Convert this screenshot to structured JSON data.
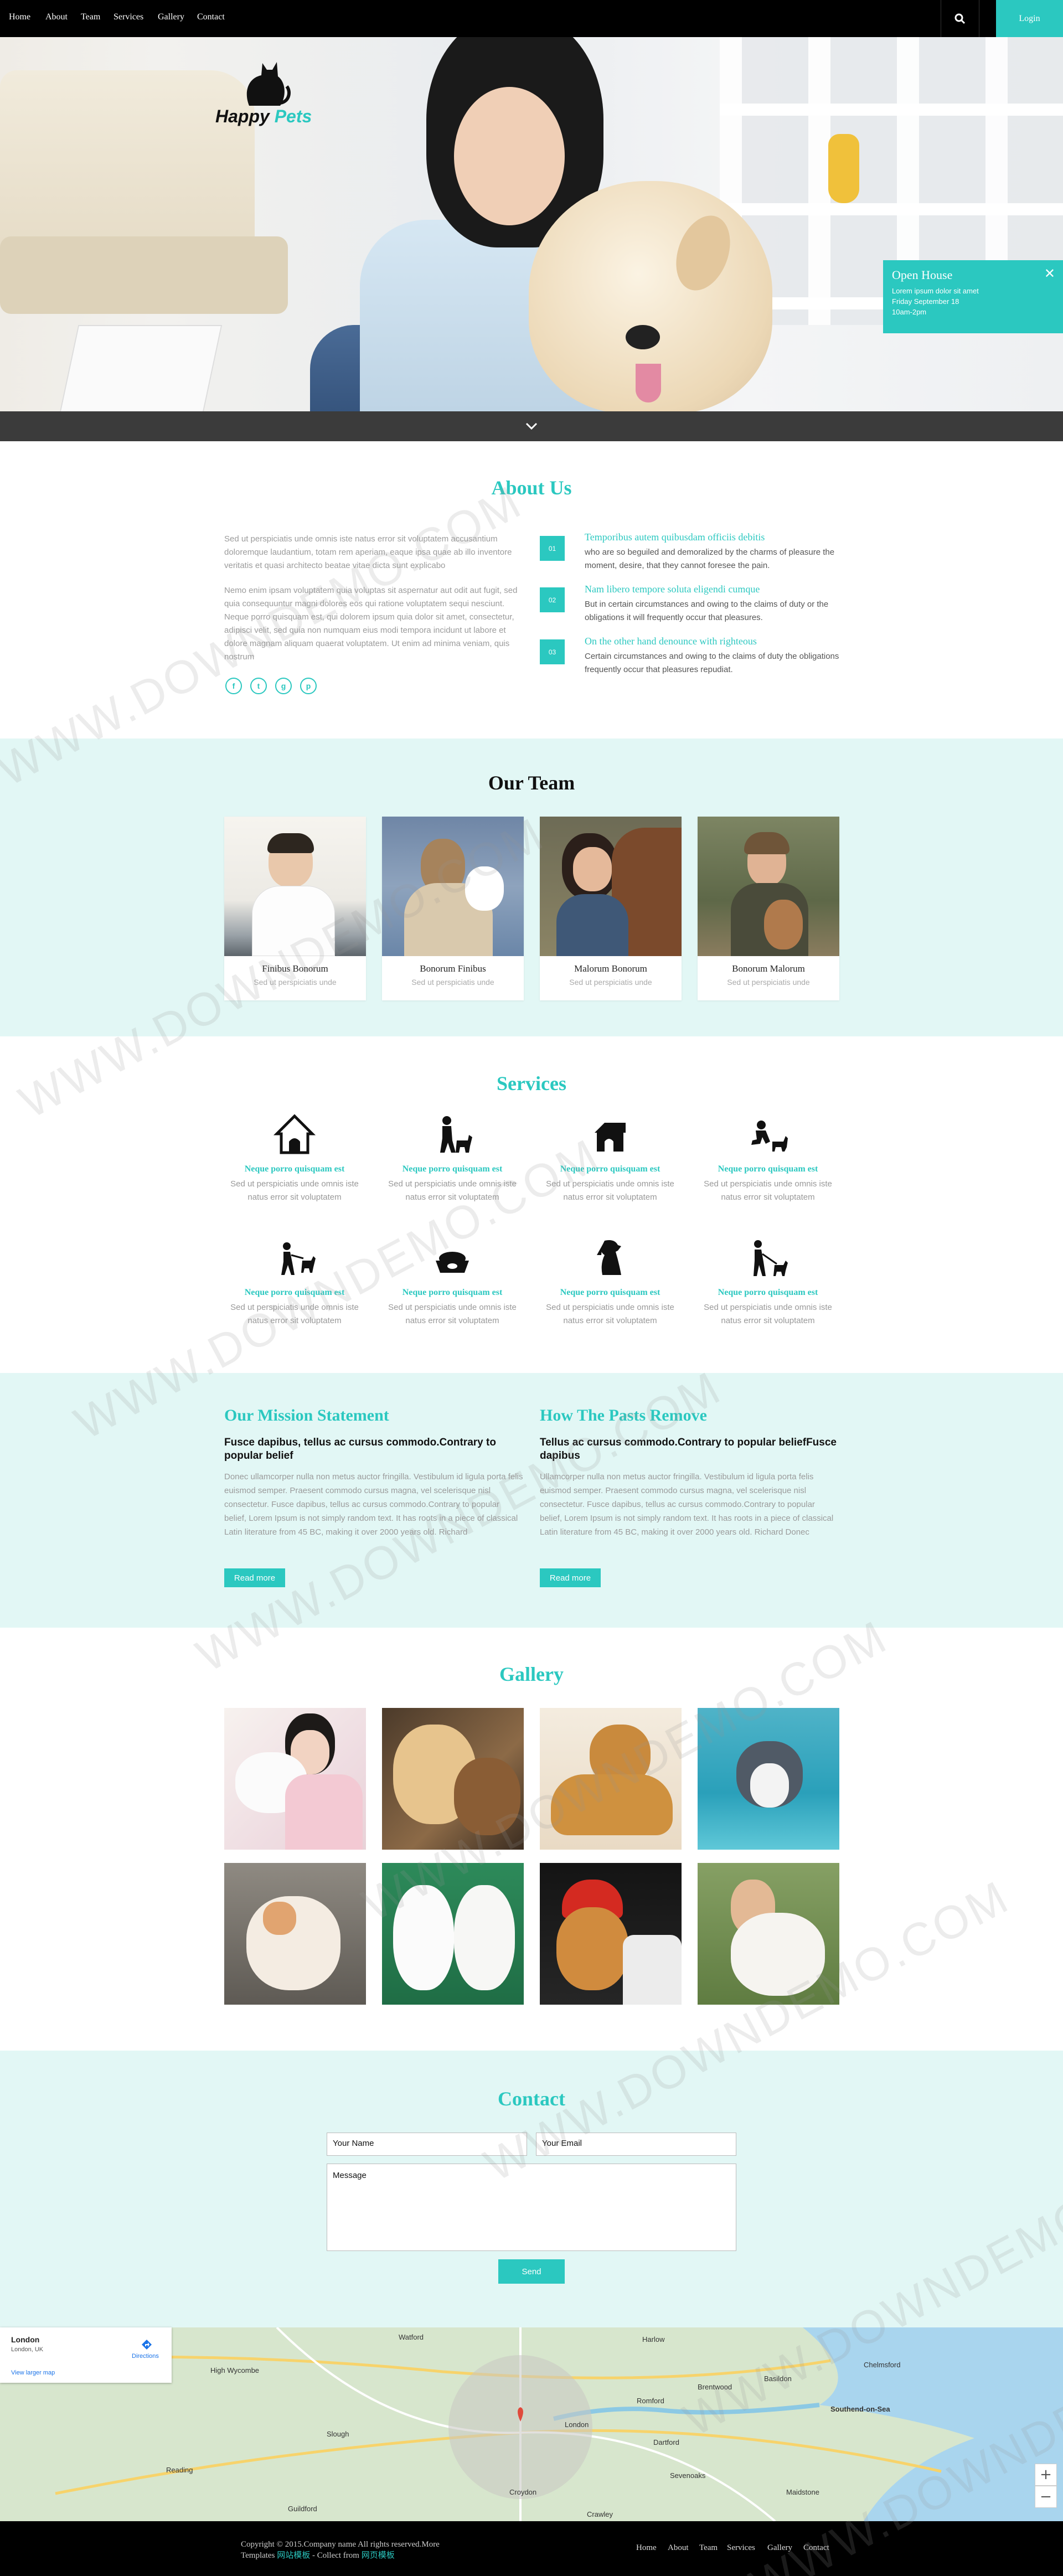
{
  "nav": {
    "items": [
      "Home",
      "About",
      "Team",
      "Services",
      "Gallery",
      "Contact"
    ],
    "login": "Login",
    "search_icon": "search-icon"
  },
  "hero": {
    "logo_word1": "Happy",
    "logo_word2": "Pets",
    "open_house": {
      "title": "Open House",
      "line1": "Lorem ipsum dolor sit amet",
      "line2": "Friday September 18",
      "line3": "10am-2pm",
      "close": "✕"
    }
  },
  "about": {
    "title": "About Us",
    "p1": "Sed ut perspiciatis unde omnis iste natus error sit voluptatem accusantium doloremque laudantium, totam rem aperiam, eaque ipsa quae ab illo inventore veritatis et quasi architecto beatae vitae dicta sunt explicabo",
    "p2": "Nemo enim ipsam voluptatem quia voluptas sit aspernatur aut odit aut fugit, sed quia consequuntur magni dolores eos qui ratione voluptatem sequi nesciunt. Neque porro quisquam est, qui dolorem ipsum quia dolor sit amet, consectetur, adipisci velit, sed quia non numquam eius modi tempora incidunt ut labore et dolore magnam aliquam quaerat voluptatem. Ut enim ad minima veniam, quis nostrum",
    "social": [
      "f",
      "t",
      "g",
      "p"
    ],
    "features": [
      {
        "num": "01",
        "title": "Temporibus autem quibusdam officiis debitis",
        "text": "who are so beguiled and demoralized by the charms of pleasure the moment, desire, that they cannot foresee the pain."
      },
      {
        "num": "02",
        "title": "Nam libero tempore soluta eligendi cumque",
        "text": "But in certain circumstances and owing to the claims of duty or the obligations it will frequently occur that pleasures."
      },
      {
        "num": "03",
        "title": "On the other hand denounce with righteous",
        "text": "Certain circumstances and owing to the claims of duty the obligations frequently occur that pleasures repudiat."
      }
    ]
  },
  "team": {
    "title": "Our Team",
    "members": [
      {
        "name": "Finibus Bonorum",
        "sub": "Sed ut perspiciatis unde"
      },
      {
        "name": "Bonorum Finibus",
        "sub": "Sed ut perspiciatis unde"
      },
      {
        "name": "Malorum Bonorum",
        "sub": "Sed ut perspiciatis unde"
      },
      {
        "name": "Bonorum Malorum",
        "sub": "Sed ut perspiciatis unde"
      }
    ]
  },
  "services": {
    "title": "Services",
    "items": [
      {
        "icon": "dog-house-icon",
        "title": "Neque porro quisquam est",
        "text": "Sed ut perspiciatis unde omnis iste natus error sit voluptatem"
      },
      {
        "icon": "dog-training-icon",
        "title": "Neque porro quisquam est",
        "text": "Sed ut perspiciatis unde omnis iste natus error sit voluptatem"
      },
      {
        "icon": "kennel-icon",
        "title": "Neque porro quisquam est",
        "text": "Sed ut perspiciatis unde omnis iste natus error sit voluptatem"
      },
      {
        "icon": "pet-grooming-icon",
        "title": "Neque porro quisquam est",
        "text": "Sed ut perspiciatis unde omnis iste natus error sit voluptatem"
      },
      {
        "icon": "dog-walking-icon",
        "title": "Neque porro quisquam est",
        "text": "Sed ut perspiciatis unde omnis iste natus error sit voluptatem"
      },
      {
        "icon": "pet-bowl-icon",
        "title": "Neque porro quisquam est",
        "text": "Sed ut perspiciatis unde omnis iste natus error sit voluptatem"
      },
      {
        "icon": "sitting-dog-icon",
        "title": "Neque porro quisquam est",
        "text": "Sed ut perspiciatis unde omnis iste natus error sit voluptatem"
      },
      {
        "icon": "dog-leash-icon",
        "title": "Neque porro quisquam est",
        "text": "Sed ut perspiciatis unde omnis iste natus error sit voluptatem"
      }
    ]
  },
  "mission": {
    "left": {
      "title": "Our Mission Statement",
      "sub": "Fusce dapibus, tellus ac cursus commodo.Contrary to popular belief",
      "text": "Donec ullamcorper nulla non metus auctor fringilla. Vestibulum id ligula porta felis euismod semper. Praesent commodo cursus magna, vel scelerisque nisl consectetur. Fusce dapibus, tellus ac cursus commodo.Contrary to popular belief, Lorem Ipsum is not simply random text. It has roots in a piece of classical Latin literature from 45 BC, making it over 2000 years old. Richard",
      "button": "Read more"
    },
    "right": {
      "title": "How The Pasts Remove",
      "sub": "Tellus ac cursus commodo.Contrary to popular beliefFusce dapibus",
      "text": "Ullamcorper nulla non metus auctor fringilla. Vestibulum id ligula porta felis euismod semper. Praesent commodo cursus magna, vel scelerisque nisl consectetur. Fusce dapibus, tellus ac cursus commodo.Contrary to popular belief, Lorem Ipsum is not simply random text. It has roots in a piece of classical Latin literature from 45 BC, making it over 2000 years old. Richard Donec",
      "button": "Read more"
    }
  },
  "gallery": {
    "title": "Gallery"
  },
  "contact": {
    "title": "Contact",
    "name_placeholder": "Your Name",
    "email_placeholder": "Your Email",
    "message_placeholder": "Message",
    "send": "Send"
  },
  "map": {
    "place": "London",
    "region": "London, UK",
    "directions": "Directions",
    "larger": "View larger map",
    "zoom_in": "+",
    "zoom_out": "−",
    "labels": [
      "Watford",
      "Harlow",
      "Brentwood",
      "Romford",
      "London",
      "Croydon",
      "Guildford",
      "Reading",
      "Slough",
      "High Wycombe",
      "Southend-on-Sea",
      "Basildon",
      "Dartford",
      "Maidstone",
      "Crawley",
      "Sevenoaks",
      "Chelmsford"
    ]
  },
  "footer": {
    "copy_line1": "Copyright © 2015.Company name All rights reserved.More",
    "copy_line2_a": "Templates",
    "copy_line2_b": "网站模板",
    "copy_line2_c": "- Collect from",
    "copy_line2_d": "网页模板",
    "nav": [
      "Home",
      "About",
      "Team",
      "Services",
      "Gallery",
      "Contact"
    ]
  },
  "watermark": "WWW.DOWNDEMO.COM",
  "colors": {
    "accent": "#2bc8c0",
    "mint": "#e2f7f5",
    "nav_bg": "#000000"
  }
}
